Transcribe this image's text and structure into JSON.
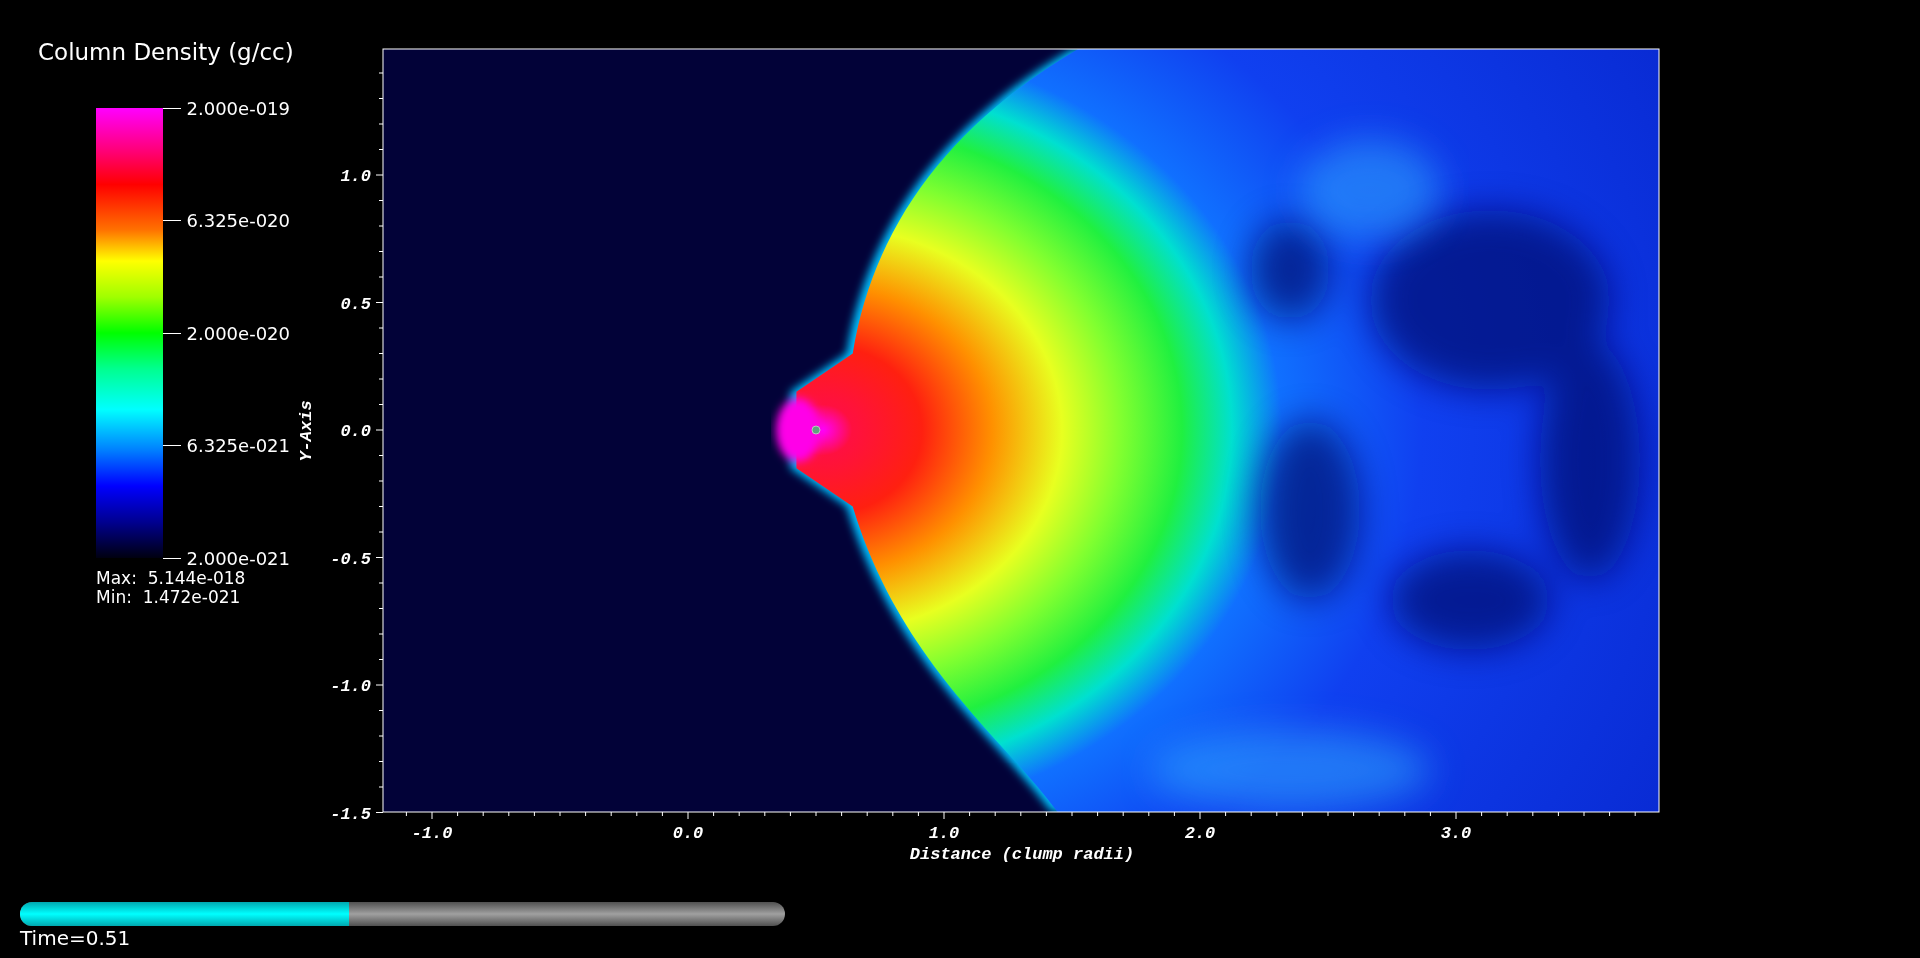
{
  "legend": {
    "title": "Column Density (g/cc)",
    "ticks": [
      "2.000e-019",
      "6.325e-020",
      "2.000e-020",
      "6.325e-021",
      "2.000e-021"
    ],
    "max_label": "Max:  5.144e-018",
    "min_label": "Min:  1.472e-021"
  },
  "plot": {
    "x_axis": {
      "title": "Distance (clump radii)",
      "ticks": [
        "-1.0",
        "0.0",
        "1.0",
        "2.0",
        "3.0"
      ]
    },
    "y_axis": {
      "title": "Y-Axis",
      "ticks": [
        "1.0",
        "0.5",
        "0.0",
        "-0.5",
        "-1.0",
        "-1.5"
      ]
    }
  },
  "time_slider": {
    "level": 0.43,
    "label": "Time=0.51"
  }
}
